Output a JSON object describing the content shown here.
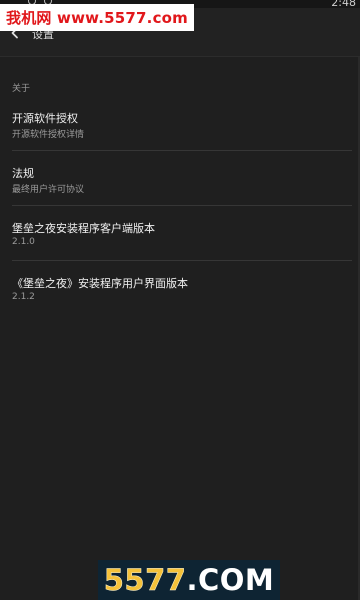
{
  "status_bar": {
    "time": "2:48"
  },
  "watermark": {
    "text": "我机网 www.5577.com"
  },
  "toolbar": {
    "title": "设置",
    "back_icon": "arrow-left-icon"
  },
  "section": {
    "header": "关于"
  },
  "items": [
    {
      "title": "开源软件授权",
      "subtitle": "开源软件授权详情"
    },
    {
      "title": "法规",
      "subtitle": "最终用户许可协议"
    },
    {
      "title": "堡垒之夜安装程序客户端版本",
      "subtitle": "2.1.0"
    },
    {
      "title": "《堡垒之夜》安装程序用户界面版本",
      "subtitle": "2.1.2"
    }
  ],
  "logo": {
    "number": "5577",
    "suffix": ".COM"
  },
  "colors": {
    "background": "#1f1f1f",
    "watermark_red": "#e1171b",
    "logo_gold": "#f5c23a"
  }
}
